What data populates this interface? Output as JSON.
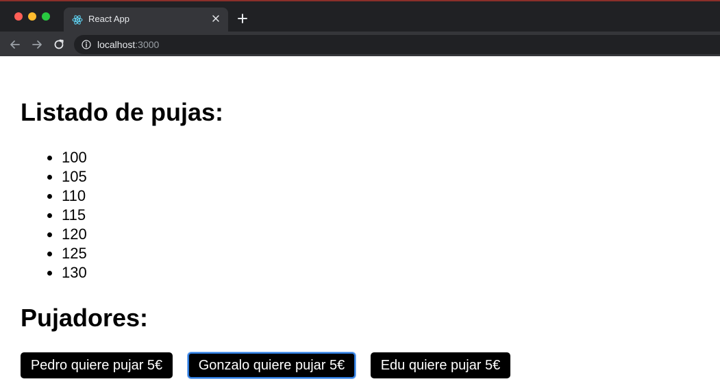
{
  "browser": {
    "tab": {
      "title": "React App",
      "favicon": "react-logo-icon"
    },
    "address_bar": {
      "host": "localhost",
      "port": ":3000"
    },
    "colors": {
      "close_dot": "#ff5f57",
      "minimize_dot": "#febc2e",
      "zoom_dot": "#28c840",
      "react_logo": "#61dafb"
    }
  },
  "page": {
    "bids_heading": "Listado de pujas:",
    "bids": [
      "100",
      "105",
      "110",
      "115",
      "120",
      "125",
      "130"
    ],
    "bidders_heading": "Pujadores:",
    "bidders": {
      "pedro_label": "Pedro quiere pujar 5€",
      "gonzalo_label": "Gonzalo quiere pujar 5€",
      "edu_label": "Edu quiere pujar 5€"
    },
    "focus_color": "#2f7de1"
  }
}
